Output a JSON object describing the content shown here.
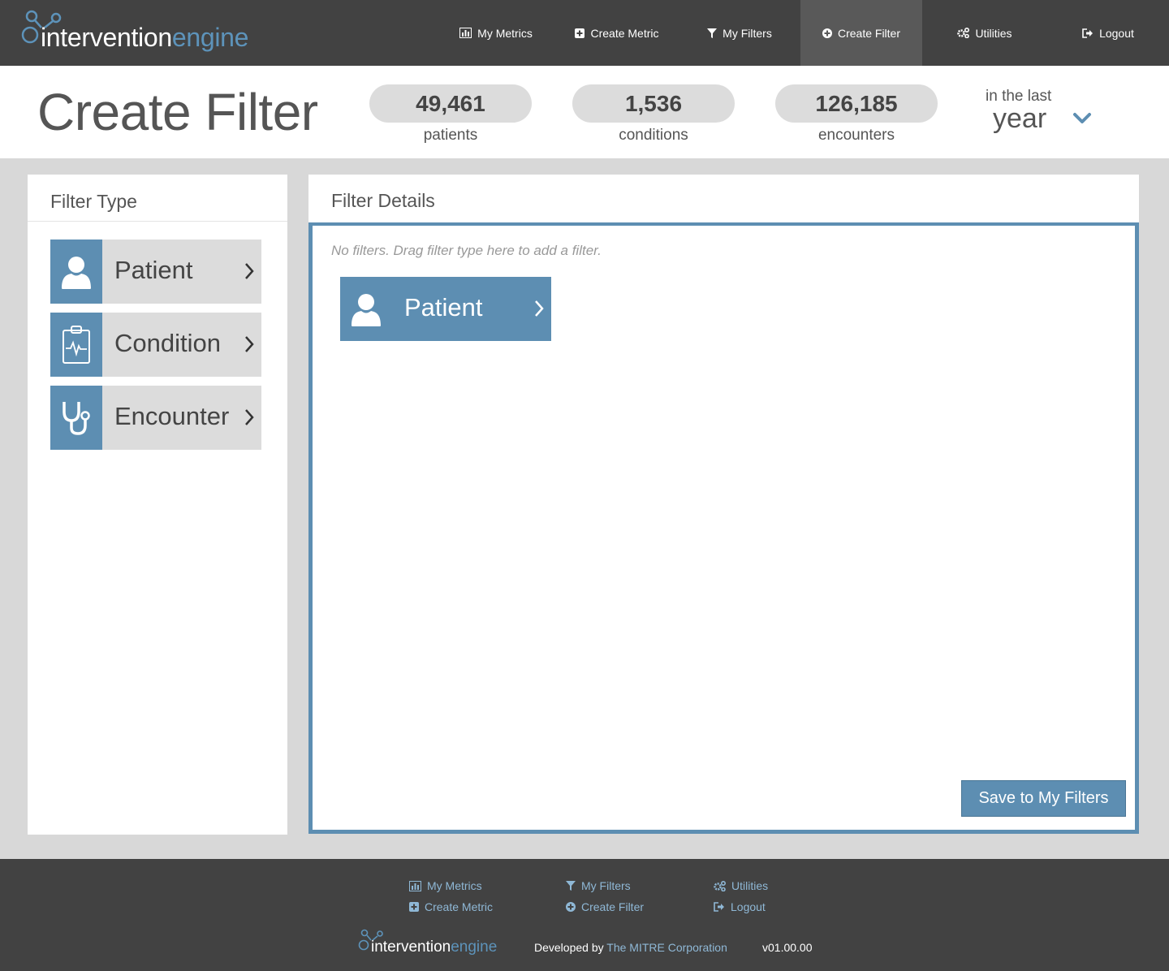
{
  "logo": {
    "part1": "intervention",
    "part2": "engine"
  },
  "nav": {
    "items": [
      {
        "label": "My Metrics",
        "icon": "bar-chart-icon"
      },
      {
        "label": "Create Metric",
        "icon": "plus-square-icon"
      },
      {
        "label": "My Filters",
        "icon": "funnel-icon"
      },
      {
        "label": "Create Filter",
        "icon": "plus-circle-icon",
        "active": true
      },
      {
        "label": "Utilities",
        "icon": "gears-icon"
      },
      {
        "label": "Logout",
        "icon": "sign-out-icon"
      }
    ]
  },
  "header": {
    "title": "Create Filter",
    "stats": [
      {
        "value": "49,461",
        "label": "patients"
      },
      {
        "value": "1,536",
        "label": "conditions"
      },
      {
        "value": "126,185",
        "label": "encounters"
      }
    ],
    "period": {
      "prefix": "in the last",
      "value": "year"
    }
  },
  "filter_type": {
    "title": "Filter Type",
    "items": [
      {
        "label": "Patient",
        "icon": "person-icon"
      },
      {
        "label": "Condition",
        "icon": "clipboard-heartbeat-icon"
      },
      {
        "label": "Encounter",
        "icon": "stethoscope-icon"
      }
    ]
  },
  "filter_details": {
    "title": "Filter Details",
    "hint": "No filters. Drag filter type here to add a filter.",
    "placed": {
      "label": "Patient",
      "icon": "person-icon"
    },
    "save_label": "Save to My Filters"
  },
  "footer": {
    "links": [
      {
        "label": "My Metrics",
        "icon": "bar-chart-icon"
      },
      {
        "label": "Create Metric",
        "icon": "plus-square-icon"
      },
      {
        "label": "My Filters",
        "icon": "funnel-icon"
      },
      {
        "label": "Create Filter",
        "icon": "plus-circle-icon"
      },
      {
        "label": "Utilities",
        "icon": "gears-icon"
      },
      {
        "label": "Logout",
        "icon": "sign-out-icon"
      }
    ],
    "developed_by": "Developed by",
    "org": "The MITRE Corporation",
    "version": "v01.00.00"
  },
  "colors": {
    "navbar": "#424242",
    "accent": "#5d8eb2",
    "active_nav": "#595959",
    "footer_link": "#8fb8d6"
  }
}
